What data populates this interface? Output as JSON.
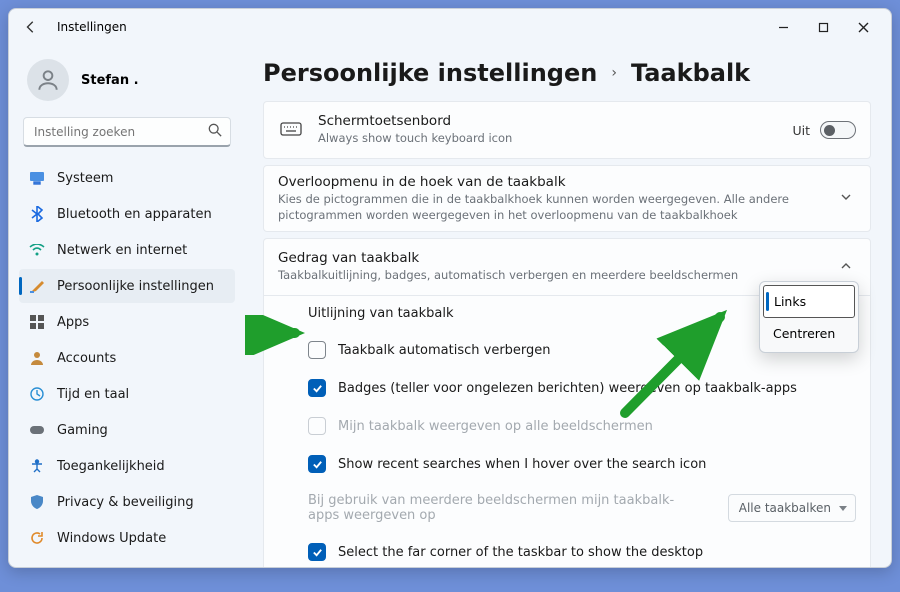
{
  "titlebar": {
    "title": "Instellingen"
  },
  "user": {
    "name": "Stefan ."
  },
  "search": {
    "placeholder": "Instelling zoeken"
  },
  "nav": [
    {
      "label": "Systeem",
      "icon": "monitor"
    },
    {
      "label": "Bluetooth en apparaten",
      "icon": "bluetooth"
    },
    {
      "label": "Netwerk en internet",
      "icon": "wifi"
    },
    {
      "label": "Persoonlijke instellingen",
      "icon": "brush",
      "active": true
    },
    {
      "label": "Apps",
      "icon": "grid"
    },
    {
      "label": "Accounts",
      "icon": "person"
    },
    {
      "label": "Tijd en taal",
      "icon": "clock"
    },
    {
      "label": "Gaming",
      "icon": "gamepad"
    },
    {
      "label": "Toegankelijkheid",
      "icon": "accessibility"
    },
    {
      "label": "Privacy & beveiliging",
      "icon": "shield"
    },
    {
      "label": "Windows Update",
      "icon": "update"
    }
  ],
  "breadcrumb": {
    "a": "Persoonlijke instellingen",
    "b": "Taakbalk"
  },
  "touchKeyboard": {
    "title": "Schermtoetsenbord",
    "subtitle": "Always show touch keyboard icon",
    "state": "Uit"
  },
  "overflow": {
    "title": "Overloopmenu in de hoek van de taakbalk",
    "subtitle": "Kies de pictogrammen die in de taakbalkhoek kunnen worden weergegeven. Alle andere pictogrammen worden weergegeven in het overloopmenu van de taakbalkhoek"
  },
  "behavior": {
    "title": "Gedrag van taakbalk",
    "subtitle": "Taakbalkuitlijning, badges, automatisch verbergen en meerdere beeldschermen",
    "alignment_label": "Uitlijning van taakbalk",
    "autohide_label": "Taakbalk automatisch verbergen",
    "badges_label": "Badges (teller voor ongelezen berichten) weergeven op taakbalk-apps",
    "multiscreen_show_label": "Mijn taakbalk weergeven op alle beeldschermen",
    "recentsearch_label": "Show recent searches when I hover over the search icon",
    "multiscreen_combine_label": "Bij gebruik van meerdere beeldschermen mijn taakbalk-apps weergeven op",
    "multiscreen_combine_value": "Alle taakbalken",
    "farcorner_label": "Select the far corner of the taskbar to show the desktop"
  },
  "dropdown": {
    "opt1": "Links",
    "opt2": "Centreren"
  }
}
